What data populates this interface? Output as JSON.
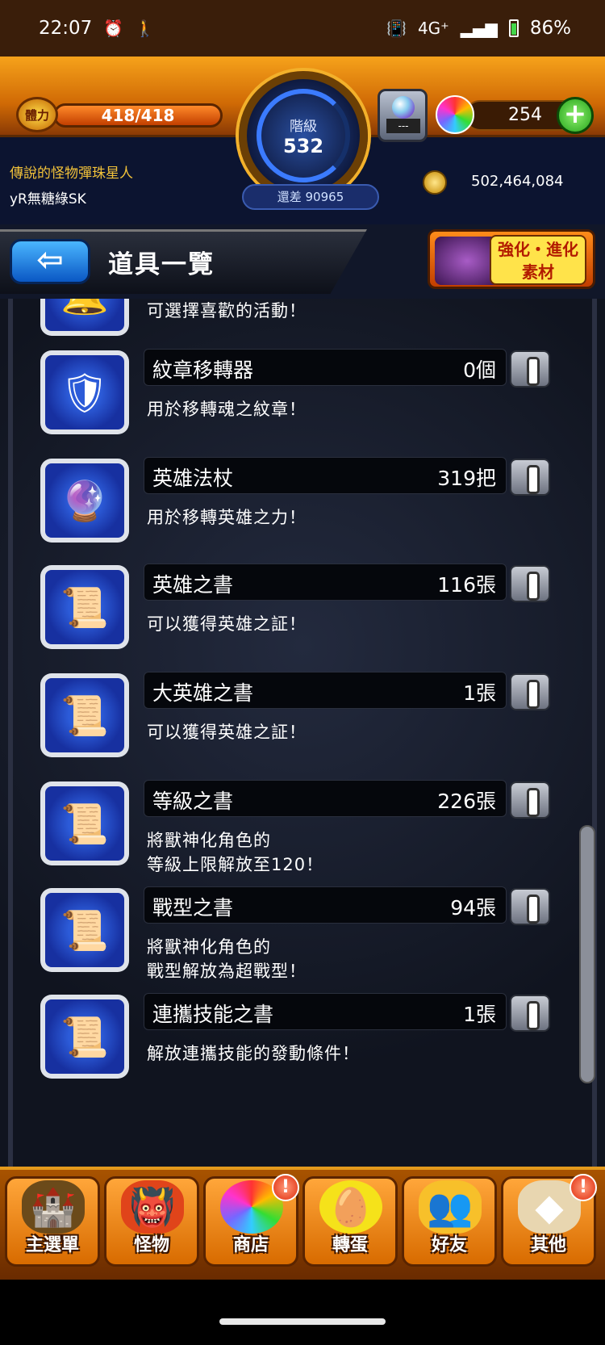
{
  "status_bar": {
    "time": "22:07",
    "network": "4G⁺",
    "battery": "86%"
  },
  "hud": {
    "stamina_label": "體力",
    "stamina": "418/418",
    "rank_label": "階級",
    "rank": "532",
    "rank_diff": "還差 90965",
    "gacha_count": "---",
    "orbs": "254"
  },
  "player": {
    "title": "傳說的怪物彈珠星人",
    "name": "yR無糖綠SK",
    "gold": "502,464,084"
  },
  "page": {
    "title": "道具一覽",
    "back_icon": "back-arrow-icon",
    "material_button": "強化・進化 素材"
  },
  "items": [
    {
      "name": "",
      "count": "",
      "desc": [
        "可選擇喜歡的活動！"
      ],
      "icon": "event-bell-icon"
    },
    {
      "name": "紋章移轉器",
      "count": "0個",
      "desc": [
        "用於移轉魂之紋章！"
      ],
      "icon": "emblem-transfer-icon"
    },
    {
      "name": "英雄法杖",
      "count": "319把",
      "desc": [
        "用於移轉英雄之力！"
      ],
      "icon": "hero-staff-icon"
    },
    {
      "name": "英雄之書",
      "count": "116張",
      "desc": [
        "可以獲得英雄之証！"
      ],
      "icon": "hero-book-icon"
    },
    {
      "name": "大英雄之書",
      "count": "1張",
      "desc": [
        "可以獲得英雄之証！"
      ],
      "icon": "great-hero-book-icon"
    },
    {
      "name": "等級之書",
      "count": "226張",
      "desc": [
        "將獸神化角色的",
        "等級上限解放至120！"
      ],
      "icon": "level-book-icon"
    },
    {
      "name": "戰型之書",
      "count": "94張",
      "desc": [
        "將獸神化角色的",
        "戰型解放為超戰型！"
      ],
      "icon": "battle-type-book-icon"
    },
    {
      "name": "連攜技能之書",
      "count": "1張",
      "desc": [
        "解放連攜技能的發動條件！"
      ],
      "icon": "link-skill-book-icon"
    }
  ],
  "nav": [
    {
      "label": "主選單",
      "icon": "castle-icon",
      "alert": false
    },
    {
      "label": "怪物",
      "icon": "monster-icon",
      "alert": false
    },
    {
      "label": "商店",
      "icon": "rainbow-orb-icon",
      "alert": true
    },
    {
      "label": "轉蛋",
      "icon": "egg-icon",
      "alert": false
    },
    {
      "label": "好友",
      "icon": "friends-icon",
      "alert": false
    },
    {
      "label": "其他",
      "icon": "other-icon",
      "alert": true
    }
  ],
  "colors": {
    "hud_orange": "#f6a21b",
    "list_bg": "#10141f",
    "icon_blue": "#2c5bd8",
    "title_gold": "#f2c23a"
  }
}
